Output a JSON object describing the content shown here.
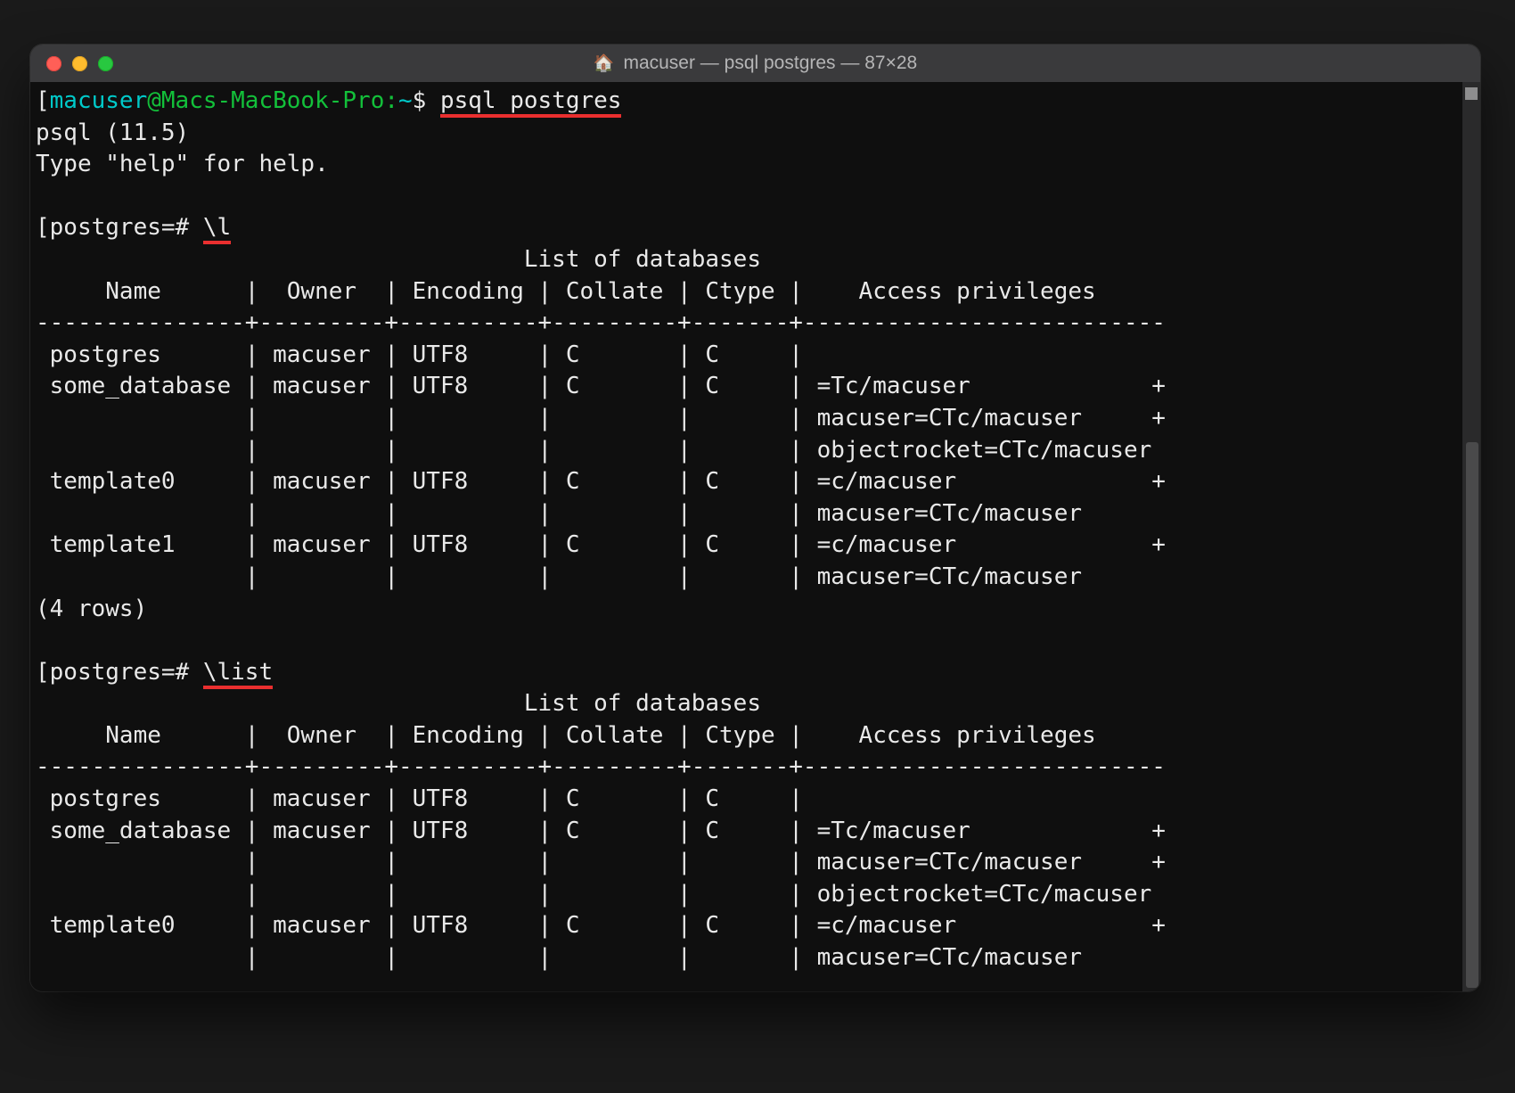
{
  "window": {
    "title": "macuser — psql postgres — 87×28"
  },
  "prompt": {
    "shell_user": "macuser",
    "shell_at": "@",
    "shell_host": "Macs-MacBook-Pro:",
    "shell_tilde": "~",
    "shell_dollar": "$ ",
    "shell_cmd": "psql postgres",
    "psql_version": "psql (11.5)",
    "psql_help": "Type \"help\" for help.",
    "psql_prompt": "postgres=# ",
    "cmd_l": "\\l",
    "cmd_list": "\\list"
  },
  "table": {
    "title": "                                   List of databases",
    "header": "     Name      |  Owner  | Encoding | Collate | Ctype |    Access privileges     ",
    "divider": "---------------+---------+----------+---------+-------+--------------------------",
    "rows": [
      " postgres      | macuser | UTF8     | C       | C     |                          ",
      " some_database | macuser | UTF8     | C       | C     | =Tc/macuser             +",
      "               |         |          |         |       | macuser=CTc/macuser     +",
      "               |         |          |         |       | objectrocket=CTc/macuser ",
      " template0     | macuser | UTF8     | C       | C     | =c/macuser              +",
      "               |         |          |         |       | macuser=CTc/macuser      ",
      " template1     | macuser | UTF8     | C       | C     | =c/macuser              +",
      "               |         |          |         |       | macuser=CTc/macuser      "
    ],
    "footer": "(4 rows)",
    "rows2": [
      " postgres      | macuser | UTF8     | C       | C     |                          ",
      " some_database | macuser | UTF8     | C       | C     | =Tc/macuser             +",
      "               |         |          |         |       | macuser=CTc/macuser     +",
      "               |         |          |         |       | objectrocket=CTc/macuser ",
      " template0     | macuser | UTF8     | C       | C     | =c/macuser              +",
      "               |         |          |         |       | macuser=CTc/macuser      "
    ]
  }
}
